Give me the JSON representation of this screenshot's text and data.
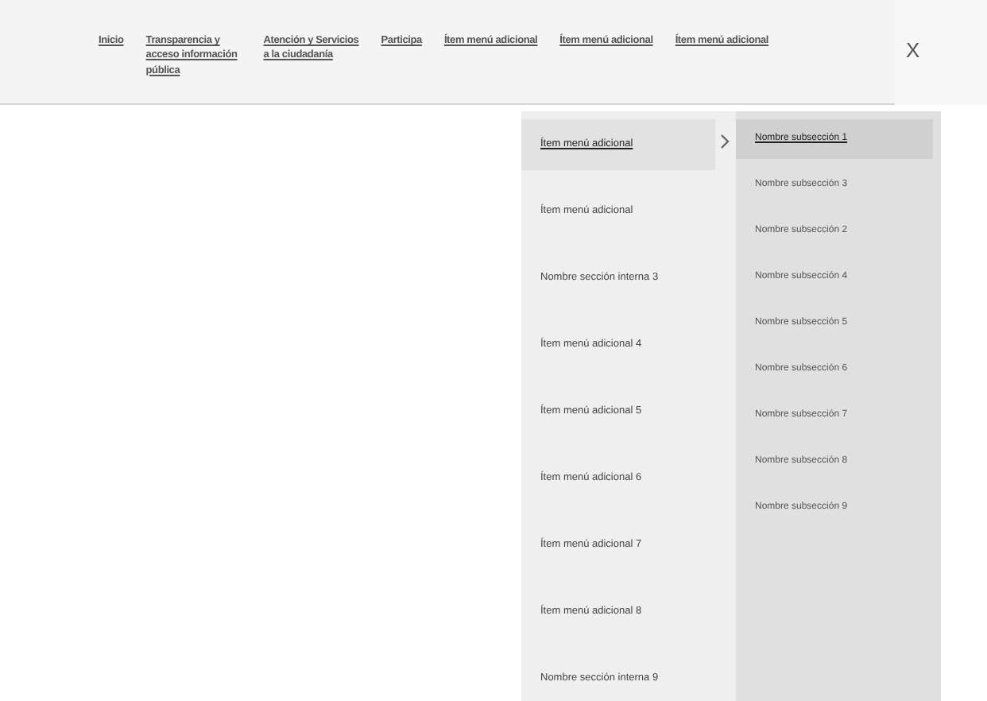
{
  "nav": [
    {
      "label": "Inicio"
    },
    {
      "label": "Transparencia y acceso información pública"
    },
    {
      "label": "Atención y Servicios a la ciudadanía"
    },
    {
      "label": "Participa"
    },
    {
      "label": "Ítem menú adicional"
    },
    {
      "label": "Ítem menú adicional"
    },
    {
      "label": "Ítem menú adicional"
    }
  ],
  "close_button": {
    "label": "X"
  },
  "menu": {
    "items": [
      {
        "label": "Ítem menú adicional",
        "selected": true
      },
      {
        "label": "Ítem menú adicional",
        "selected": false
      },
      {
        "label": "Nombre sección interna 3",
        "selected": false
      },
      {
        "label": "Ítem menú adicional 4",
        "selected": false
      },
      {
        "label": "Ítem menú adicional 5",
        "selected": false
      },
      {
        "label": "Ítem menú adicional 6",
        "selected": false
      },
      {
        "label": "Ítem menú adicional 7",
        "selected": false
      },
      {
        "label": "Ítem menú adicional 8",
        "selected": false
      },
      {
        "label": "Nombre sección interna 9",
        "selected": false
      }
    ],
    "submenu": [
      {
        "label": "Nombre subsección 1",
        "selected": true
      },
      {
        "label": "Nombre subsección 3",
        "selected": false
      },
      {
        "label": "Nombre subsección 2",
        "selected": false
      },
      {
        "label": "Nombre subsección 4",
        "selected": false
      },
      {
        "label": "Nombre subsección 5",
        "selected": false
      },
      {
        "label": "Nombre subsección 6",
        "selected": false
      },
      {
        "label": "Nombre subsección 7",
        "selected": false
      },
      {
        "label": "Nombre subsección 8",
        "selected": false
      },
      {
        "label": "Nombre subsección 9",
        "selected": false
      }
    ]
  }
}
